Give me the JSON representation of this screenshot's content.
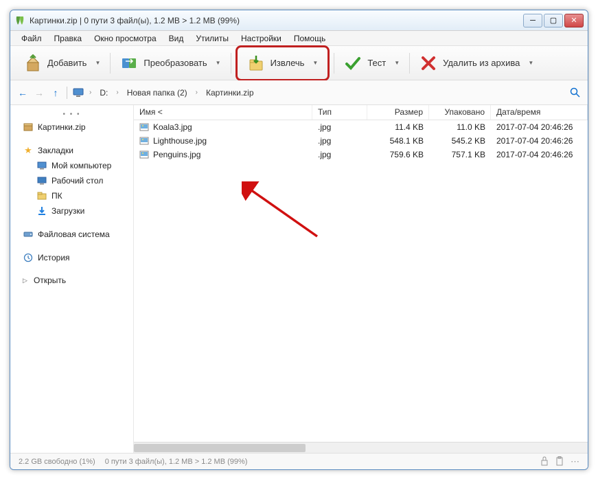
{
  "title": "Картинки.zip | 0 пути 3 файл(ы), 1.2 MB > 1.2 MB (99%)",
  "menubar": [
    "Файл",
    "Правка",
    "Окно просмотра",
    "Вид",
    "Утилиты",
    "Настройки",
    "Помощь"
  ],
  "toolbar": {
    "add": "Добавить",
    "convert": "Преобразовать",
    "extract": "Извлечь",
    "test": "Тест",
    "delete": "Удалить из архива"
  },
  "path": {
    "segments": [
      "D:",
      "Новая папка (2)",
      "Картинки.zip"
    ]
  },
  "sidebar": {
    "archive": "Картинки.zip",
    "bookmarks_label": "Закладки",
    "bookmarks": [
      "Мой компьютер",
      "Рабочий стол",
      "ПК",
      "Загрузки"
    ],
    "filesystem": "Файловая система",
    "history": "История",
    "open": "Открыть"
  },
  "columns": {
    "name": "Имя <",
    "type": "Тип",
    "size": "Размер",
    "packed": "Упаковано",
    "date": "Дата/время"
  },
  "files": [
    {
      "name": "Koala3.jpg",
      "type": ".jpg",
      "size": "11.4 KB",
      "packed": "11.0 KB",
      "date": "2017-07-04 20:46:26"
    },
    {
      "name": "Lighthouse.jpg",
      "type": ".jpg",
      "size": "548.1 KB",
      "packed": "545.2 KB",
      "date": "2017-07-04 20:46:26"
    },
    {
      "name": "Penguins.jpg",
      "type": ".jpg",
      "size": "759.6 KB",
      "packed": "757.1 KB",
      "date": "2017-07-04 20:46:26"
    }
  ],
  "status": {
    "free": "2.2 GB свободно (1%)",
    "selection": "0 пути 3 файл(ы), 1.2 MB > 1.2 MB (99%)"
  }
}
